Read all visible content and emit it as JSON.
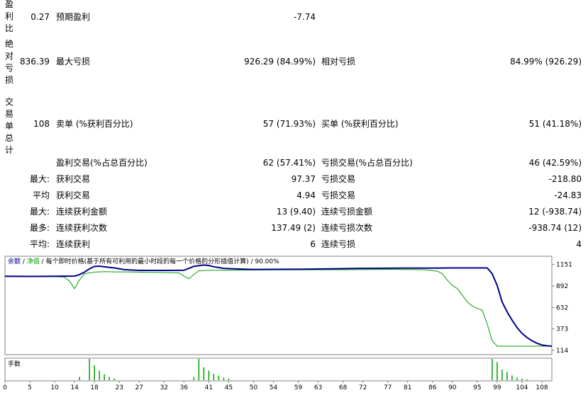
{
  "stats": {
    "profit_ratio_label": "盈利比",
    "profit_ratio_value": "0.27",
    "expected_payoff_label": "预期盈利",
    "expected_payoff_value": "-7.74",
    "abs_drawdown_label": "绝对亏损",
    "abs_drawdown_value": "836.39",
    "max_drawdown_label": "最大亏损",
    "max_drawdown_value": "926.29 (84.99%)",
    "rel_drawdown_label": "相对亏损",
    "rel_drawdown_value": "84.99% (926.29)",
    "total_trades_label": "交易单总计",
    "total_trades_value": "108",
    "short_label": "卖单 (%获利百分比)",
    "short_value": "57 (71.93%)",
    "long_label": "买单 (%获利百分比)",
    "long_value": "51 (41.18%)",
    "profit_trades_label": "盈利交易(%占总百分比)",
    "profit_trades_value": "62 (57.41%)",
    "loss_trades_label": "亏损交易(%占总百分比)",
    "loss_trades_value": "46 (42.59%)",
    "rows": [
      {
        "prefix": "最大:",
        "l_label": "获利交易",
        "l_value": "97.37",
        "r_label": "亏损交易",
        "r_value": "-218.80"
      },
      {
        "prefix": "平均",
        "l_label": "获利交易",
        "l_value": "4.94",
        "r_label": "亏损交易",
        "r_value": "-24.83"
      },
      {
        "prefix": "最大:",
        "l_label": "连续获利金额",
        "l_value": "13 (9.40)",
        "r_label": "连续亏损金额",
        "r_value": "12 (-938.74)"
      },
      {
        "prefix": "最多:",
        "l_label": "连续获利次数",
        "l_value": "137.49 (2)",
        "r_label": "连续亏损次数",
        "r_value": "-938.74 (12)"
      },
      {
        "prefix": "平均:",
        "l_label": "连续获利",
        "l_value": "6",
        "r_label": "连续亏损",
        "r_value": "4"
      }
    ]
  },
  "chart_data": {
    "type": "line",
    "legend": {
      "balance": "余额",
      "sep1": " / ",
      "equity": "净值",
      "sep2": " / ",
      "desc": "每个即时价格(基于所有可利用的最小时段的每一个价格的分形插值计算)",
      "sep3": " / ",
      "quality": "90.00%"
    },
    "ylim": [
      114,
      1200
    ],
    "y_ticks": [
      1151,
      892,
      632,
      373,
      114
    ],
    "x_ticks": [
      0,
      5,
      10,
      14,
      18,
      23,
      27,
      32,
      36,
      41,
      45,
      50,
      54,
      59,
      63,
      68,
      72,
      77,
      81,
      86,
      90,
      95,
      99,
      104,
      108
    ],
    "xlim": [
      0,
      110
    ],
    "series": [
      {
        "name": "余额",
        "color": "#00008b",
        "points": [
          [
            0,
            1010
          ],
          [
            5,
            1008
          ],
          [
            10,
            1010
          ],
          [
            14,
            1012
          ],
          [
            15,
            1030
          ],
          [
            16,
            1060
          ],
          [
            17,
            1100
          ],
          [
            18,
            1128
          ],
          [
            19,
            1132
          ],
          [
            20,
            1124
          ],
          [
            22,
            1110
          ],
          [
            24,
            1090
          ],
          [
            27,
            1080
          ],
          [
            32,
            1080
          ],
          [
            36,
            1082
          ],
          [
            37,
            1105
          ],
          [
            38,
            1130
          ],
          [
            40,
            1145
          ],
          [
            41,
            1140
          ],
          [
            42,
            1125
          ],
          [
            44,
            1105
          ],
          [
            46,
            1100
          ],
          [
            48,
            1095
          ],
          [
            50,
            1092
          ],
          [
            60,
            1095
          ],
          [
            68,
            1102
          ],
          [
            72,
            1105
          ],
          [
            80,
            1108
          ],
          [
            86,
            1108
          ],
          [
            90,
            1110
          ],
          [
            97,
            1110
          ],
          [
            98,
            1040
          ],
          [
            99,
            900
          ],
          [
            100,
            700
          ],
          [
            101,
            580
          ],
          [
            102,
            480
          ],
          [
            103,
            390
          ],
          [
            104,
            320
          ],
          [
            105,
            270
          ],
          [
            106,
            230
          ],
          [
            107,
            200
          ],
          [
            108,
            180
          ],
          [
            109,
            170
          ],
          [
            110,
            165
          ]
        ]
      },
      {
        "name": "净值",
        "color": "#00a000",
        "points": [
          [
            0,
            1005
          ],
          [
            10,
            1005
          ],
          [
            12,
            1000
          ],
          [
            13,
            950
          ],
          [
            14,
            860
          ],
          [
            15,
            965
          ],
          [
            16,
            1040
          ],
          [
            17,
            1050
          ],
          [
            18,
            1060
          ],
          [
            20,
            1065
          ],
          [
            22,
            1062
          ],
          [
            25,
            1062
          ],
          [
            28,
            1058
          ],
          [
            32,
            1055
          ],
          [
            35,
            1050
          ],
          [
            36,
            1010
          ],
          [
            37,
            980
          ],
          [
            38,
            1030
          ],
          [
            39,
            1075
          ],
          [
            41,
            1082
          ],
          [
            45,
            1082
          ],
          [
            50,
            1085
          ],
          [
            60,
            1088
          ],
          [
            70,
            1090
          ],
          [
            78,
            1092
          ],
          [
            83,
            1090
          ],
          [
            85,
            1085
          ],
          [
            87,
            1070
          ],
          [
            88,
            1040
          ],
          [
            89,
            960
          ],
          [
            90,
            900
          ],
          [
            91,
            860
          ],
          [
            92,
            780
          ],
          [
            93,
            700
          ],
          [
            94,
            650
          ],
          [
            95,
            620
          ],
          [
            96,
            600
          ],
          [
            97,
            430
          ],
          [
            98,
            230
          ],
          [
            99,
            165
          ],
          [
            110,
            165
          ]
        ]
      }
    ],
    "volume": {
      "label": "手数",
      "bars": [
        [
          15,
          0.15
        ],
        [
          17,
          1
        ],
        [
          18,
          0.7
        ],
        [
          19,
          0.45
        ],
        [
          20,
          0.28
        ],
        [
          21,
          0.15
        ],
        [
          22,
          0.08
        ],
        [
          38,
          0.15
        ],
        [
          39,
          1
        ],
        [
          40,
          0.6
        ],
        [
          41,
          0.45
        ],
        [
          42,
          0.3
        ],
        [
          43,
          0.22
        ],
        [
          44,
          0.12
        ],
        [
          45,
          0.08
        ],
        [
          98,
          1
        ],
        [
          99,
          0.85
        ],
        [
          100,
          0.5
        ],
        [
          101,
          0.38
        ],
        [
          102,
          0.22
        ],
        [
          103,
          0.12
        ],
        [
          104,
          0.07
        ],
        [
          105,
          0.04
        ]
      ]
    }
  }
}
